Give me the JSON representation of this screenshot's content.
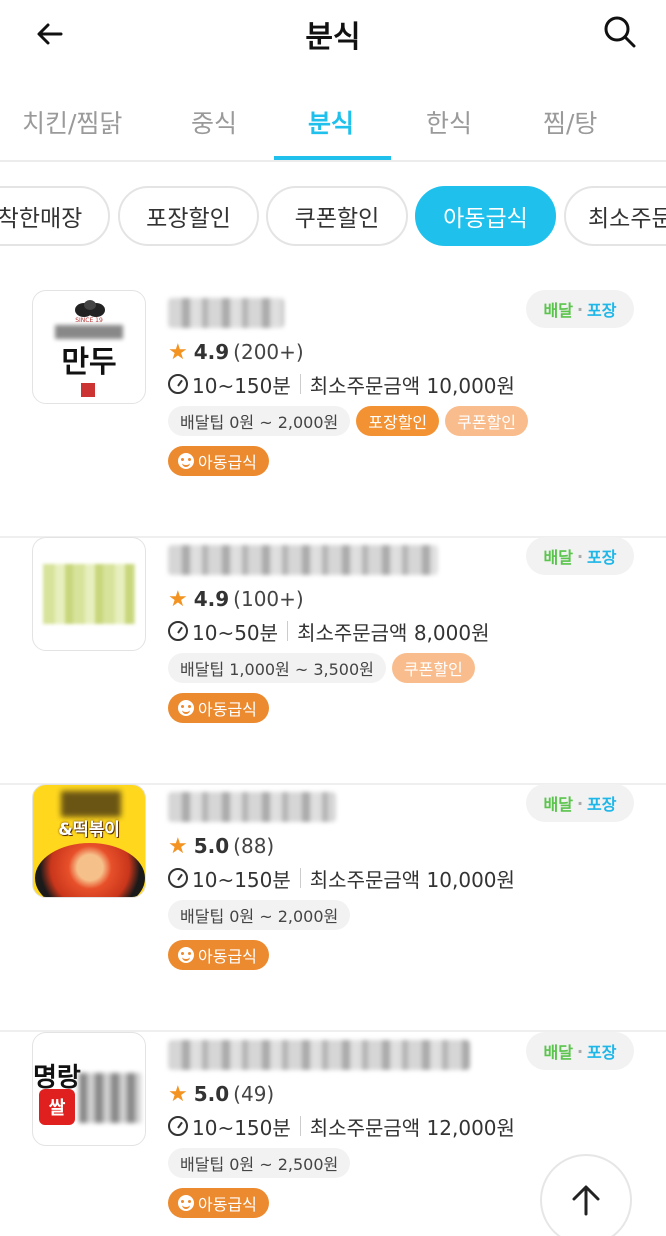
{
  "header": {
    "title": "분식",
    "back_icon": "arrow-left-icon",
    "search_icon": "search-icon"
  },
  "tabs": [
    {
      "label": "치킨/찜닭",
      "active": false
    },
    {
      "label": "중식",
      "active": false
    },
    {
      "label": "분식",
      "active": true
    },
    {
      "label": "한식",
      "active": false
    },
    {
      "label": "찜/탕",
      "active": false
    }
  ],
  "filters": [
    {
      "label": "착한매장",
      "active": false
    },
    {
      "label": "포장할인",
      "active": false
    },
    {
      "label": "쿠폰할인",
      "active": false
    },
    {
      "label": "아동급식",
      "active": true
    },
    {
      "label": "최소주문",
      "active": false
    }
  ],
  "colors": {
    "accent": "#1fc1ec",
    "star": "#f39321",
    "packing_tag": "#f39233",
    "coupon_tag": "#f9bd8d",
    "kids_tag": "#ec8a2f",
    "delivery_green": "#5ac44c"
  },
  "stores": [
    {
      "logo_text": "만두",
      "rating": "4.9",
      "reviews": "(200+)",
      "time": "10~150분",
      "min_order": "최소주문금액 10,000원",
      "delivery_tip": "배달팁 0원 ~ 2,000원",
      "tags": [
        "포장할인",
        "쿠폰할인"
      ],
      "kids": "아동급식",
      "badge": {
        "delivery": "배달",
        "dot": "·",
        "pickup": "포장"
      }
    },
    {
      "rating": "4.9",
      "reviews": "(100+)",
      "time": "10~50분",
      "min_order": "최소주문금액 8,000원",
      "delivery_tip": "배달팁 1,000원 ~ 3,500원",
      "tags": [
        "쿠폰할인"
      ],
      "kids": "아동급식",
      "badge": {
        "delivery": "배달",
        "dot": "·",
        "pickup": "포장"
      }
    },
    {
      "logo_text": "&떡볶이",
      "rating": "5.0",
      "reviews": "(88)",
      "time": "10~150분",
      "min_order": "최소주문금액 10,000원",
      "delivery_tip": "배달팁 0원 ~ 2,000원",
      "tags": [],
      "kids": "아동급식",
      "badge": {
        "delivery": "배달",
        "dot": "·",
        "pickup": "포장"
      }
    },
    {
      "logo_text": "명랑",
      "logo_sub": "쌀",
      "rating": "5.0",
      "reviews": "(49)",
      "time": "10~150분",
      "min_order": "최소주문금액 12,000원",
      "delivery_tip": "배달팁 0원 ~ 2,500원",
      "tags": [],
      "kids": "아동급식",
      "badge": {
        "delivery": "배달",
        "dot": "·",
        "pickup": "포장"
      }
    }
  ],
  "scroll_top_icon": "arrow-up-icon"
}
